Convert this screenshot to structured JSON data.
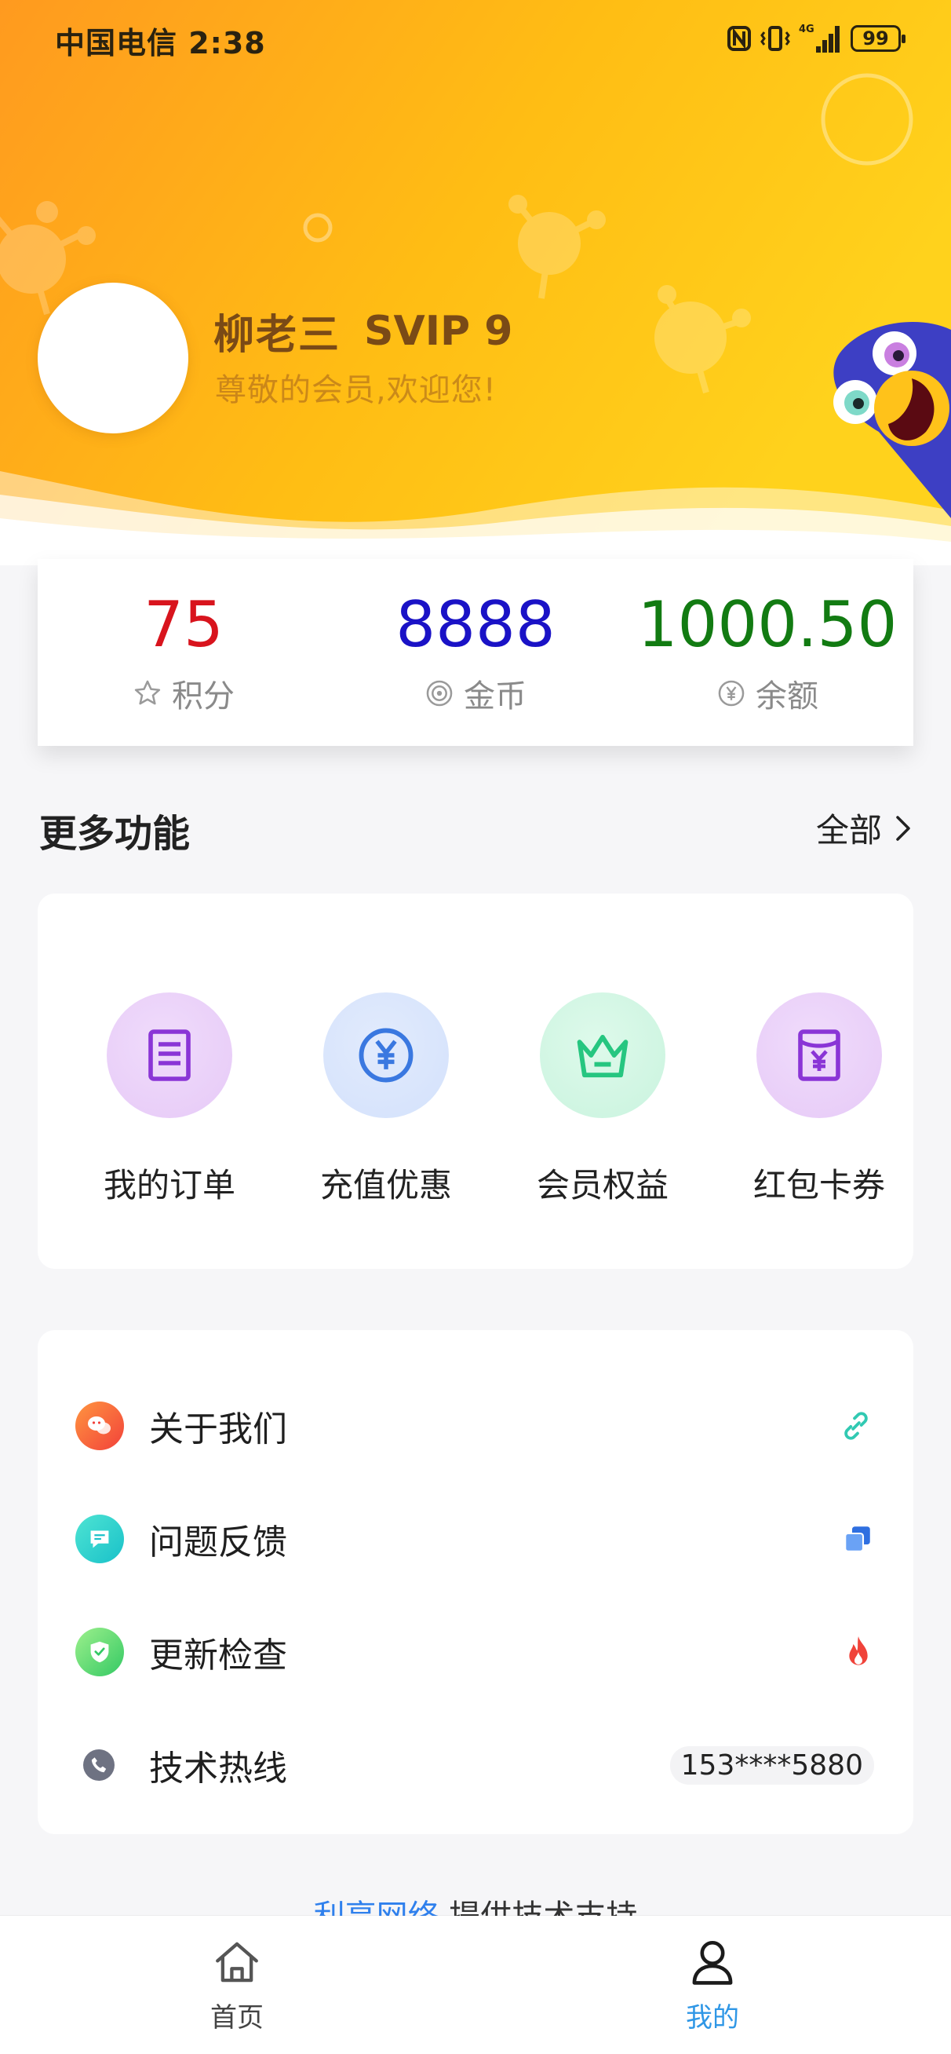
{
  "status_bar": {
    "carrier_time": "中国电信 2:38",
    "network": "4G",
    "battery": "99"
  },
  "profile": {
    "name": "柳老三",
    "vip": "SVIP 9",
    "greeting": "尊敬的会员,欢迎您!"
  },
  "stats": [
    {
      "value": "75",
      "label": "积分",
      "color": "#d8141d",
      "icon": "star-icon"
    },
    {
      "value": "8888",
      "label": "金币",
      "color": "#1a12c6",
      "icon": "coin-icon"
    },
    {
      "value": "1000.50",
      "label": "余额",
      "color": "#127b12",
      "icon": "yuan-icon"
    }
  ],
  "functions": {
    "title": "更多功能",
    "view_all": "全部",
    "items": [
      {
        "label": "我的订单",
        "icon": "order-icon",
        "color": "#8a35d6"
      },
      {
        "label": "充值优惠",
        "icon": "yuan-coin-icon",
        "color": "#3a78e0"
      },
      {
        "label": "会员权益",
        "icon": "crown-icon",
        "color": "#26c680"
      },
      {
        "label": "红包卡券",
        "icon": "red-packet-icon",
        "color": "#8a35d6"
      }
    ]
  },
  "menu": [
    {
      "label": "关于我们",
      "icon": "wechat-icon",
      "trail_icon": "link-icon"
    },
    {
      "label": "问题反馈",
      "icon": "feedback-icon",
      "trail_icon": "copy-icon"
    },
    {
      "label": "更新检查",
      "icon": "shield-check-icon",
      "trail_icon": "fire-icon"
    },
    {
      "label": "技术热线",
      "icon": "phone-icon",
      "trail_text": "153****5880"
    }
  ],
  "footer": {
    "brand": "利享网络",
    "text": "提供技术支持"
  },
  "tabs": [
    {
      "label": "首页",
      "icon": "home-icon",
      "active": false
    },
    {
      "label": "我的",
      "icon": "user-icon",
      "active": true
    }
  ],
  "colors": {
    "header_start": "#ff9a1f",
    "header_end": "#ffd21c",
    "active_tab": "#2f97e6"
  }
}
